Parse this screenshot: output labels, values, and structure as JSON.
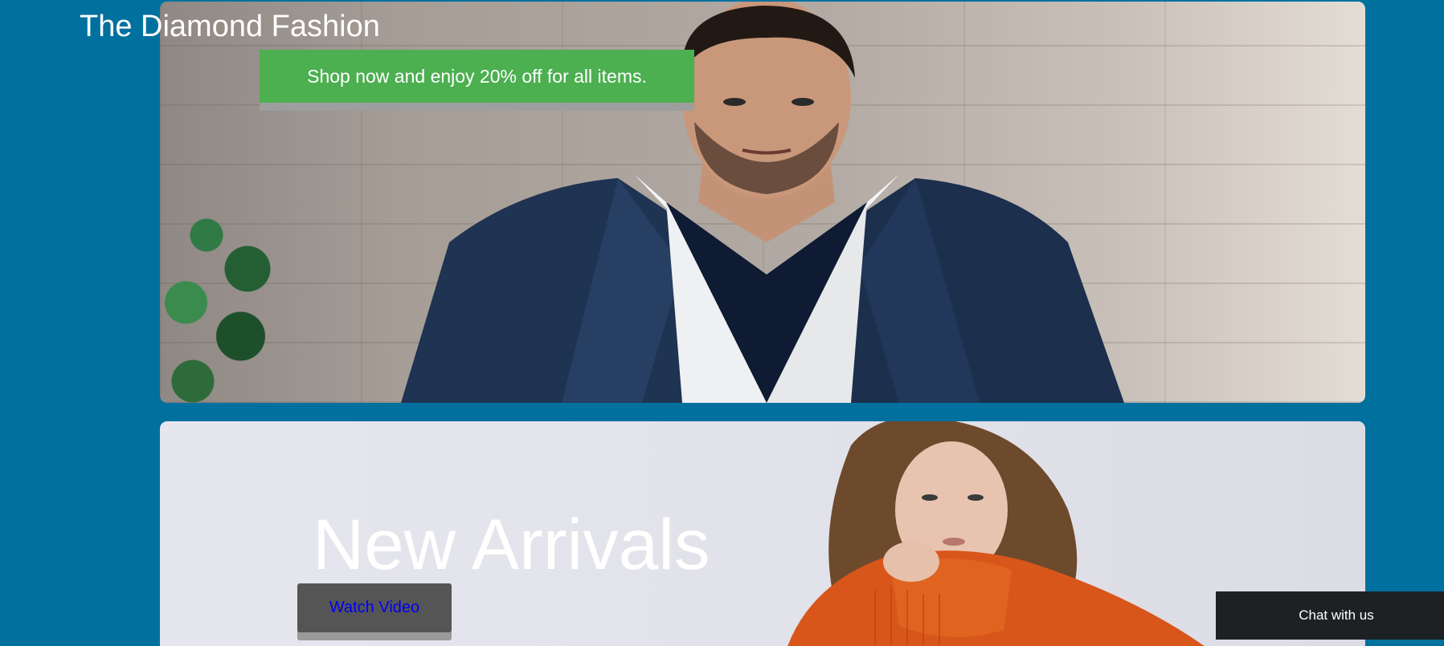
{
  "site": {
    "title": "The Diamond Fashion"
  },
  "hero": {
    "promo_text": "Shop now and enjoy 20% off for all items.",
    "image_subject": "man-in-suit-photo"
  },
  "arrivals": {
    "heading": "New Arrivals",
    "watch_video_label": "Watch Video",
    "image_subject": "woman-in-orange-coat-photo"
  },
  "chat": {
    "label": "Chat with us"
  },
  "colors": {
    "page_background": "#00719f",
    "promo_green": "#4caf50",
    "button_gray": "#555555",
    "link_blue": "#0000ee",
    "chat_dark": "#1e2124"
  }
}
